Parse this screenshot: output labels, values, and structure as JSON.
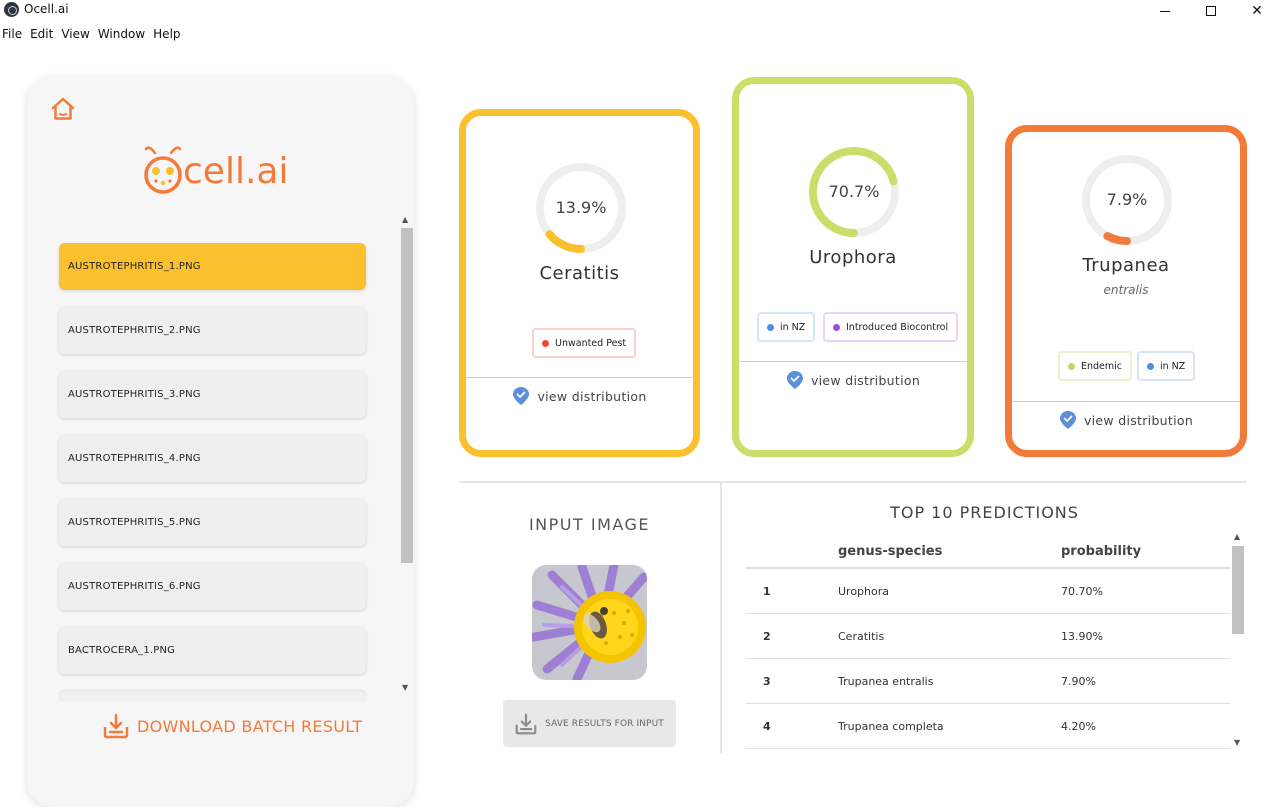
{
  "window": {
    "title": "Ocell.ai",
    "controls": {
      "minimize": "minimize",
      "maximize": "maximize",
      "close": "✕"
    }
  },
  "menu": [
    "File",
    "Edit",
    "View",
    "Window",
    "Help"
  ],
  "sidebar": {
    "logo_text": "cell.ai",
    "files": [
      "AUSTROTEPHRITIS_1.PNG",
      "AUSTROTEPHRITIS_2.PNG",
      "AUSTROTEPHRITIS_3.PNG",
      "AUSTROTEPHRITIS_4.PNG",
      "AUSTROTEPHRITIS_5.PNG",
      "AUSTROTEPHRITIS_6.PNG",
      "BACTROCERA_1.PNG"
    ],
    "selected_index": 0,
    "download_label": "DOWNLOAD BATCH RESULT"
  },
  "cards": [
    {
      "percent_label": "13.9%",
      "percent": 13.9,
      "genus": "Ceratitis",
      "species": "",
      "badges": [
        {
          "label": "Unwanted Pest",
          "dot": "#f44336",
          "border": "#f8d0cc"
        }
      ],
      "view_label": "view distribution",
      "color": "#fbc02d"
    },
    {
      "percent_label": "70.7%",
      "percent": 70.7,
      "genus": "Urophora",
      "species": "",
      "badges": [
        {
          "label": "in NZ",
          "dot": "#4a90e2",
          "border": "#d6e4f7"
        },
        {
          "label": "Introduced Biocontrol",
          "dot": "#9c4ddb",
          "border": "#e7d6f6"
        }
      ],
      "view_label": "view distribution",
      "color": "#c8e06a"
    },
    {
      "percent_label": "7.9%",
      "percent": 7.9,
      "genus": "Trupanea",
      "species": "entralis",
      "badges": [
        {
          "label": "Endemic",
          "dot": "#b7db5c",
          "border": "#e8f2cf"
        },
        {
          "label": "in NZ",
          "dot": "#4a90e2",
          "border": "#d6e4f7"
        }
      ],
      "view_label": "view distribution",
      "color": "#f47a3a"
    }
  ],
  "input": {
    "title": "INPUT IMAGE",
    "save_label": "SAVE RESULTS FOR INPUT"
  },
  "predictions": {
    "title": "TOP 10 PREDICTIONS",
    "headers": [
      "",
      "genus-species",
      "probability"
    ],
    "rows": [
      [
        "1",
        "Urophora",
        "70.70%"
      ],
      [
        "2",
        "Ceratitis",
        "13.90%"
      ],
      [
        "3",
        "Trupanea entralis",
        "7.90%"
      ],
      [
        "4",
        "Trupanea completa",
        "4.20%"
      ]
    ]
  }
}
